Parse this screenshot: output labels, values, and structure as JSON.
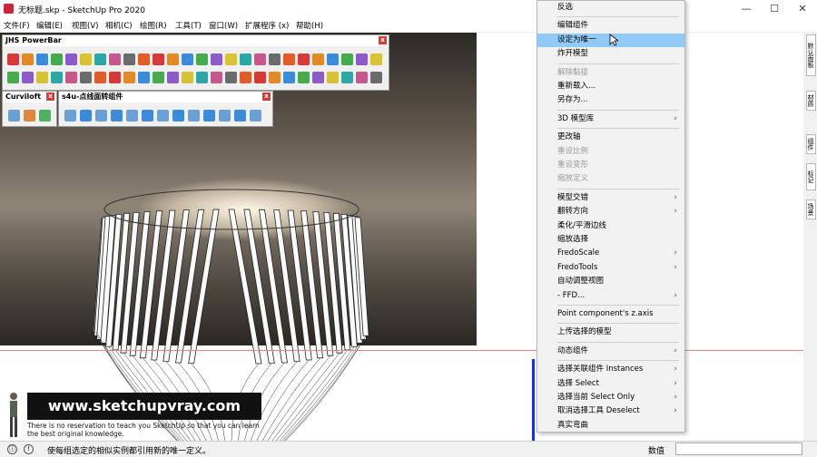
{
  "window": {
    "title": "无标题.skp - SketchUp Pro 2020",
    "minimize": "—",
    "maximize": "☐",
    "close": "✕"
  },
  "menubar": {
    "items": [
      "文件(F)",
      "编辑(E)",
      "视图(V)",
      "相机(C)",
      "绘图(R)",
      "工具(T)",
      "窗口(W)",
      "扩展程序 (x)",
      "帮助(H)"
    ]
  },
  "toolbars": {
    "powerbar": {
      "title": "JHS PowerBar",
      "close": "x"
    },
    "curviloft": {
      "title": "Curviloft",
      "close": "x"
    },
    "s4u": {
      "title": "s4u-点线面转组件",
      "close": "x"
    }
  },
  "context_menu": {
    "items": [
      {
        "label": "反选",
        "disabled": false,
        "submenu": false
      },
      {
        "label": "编辑组件",
        "disabled": false,
        "submenu": false
      },
      {
        "label": "设定为唯一",
        "disabled": false,
        "submenu": false,
        "highlighted": true
      },
      {
        "label": "炸开模型",
        "disabled": false,
        "submenu": false
      },
      {
        "label": "解除黏接",
        "disabled": true,
        "submenu": false
      },
      {
        "label": "重新载入...",
        "disabled": false,
        "submenu": false
      },
      {
        "label": "另存为...",
        "disabled": false,
        "submenu": false
      },
      {
        "label": "3D 模型库",
        "disabled": false,
        "submenu": true
      },
      {
        "label": "更改轴",
        "disabled": false,
        "submenu": false
      },
      {
        "label": "重设比例",
        "disabled": true,
        "submenu": false
      },
      {
        "label": "重设变形",
        "disabled": true,
        "submenu": false
      },
      {
        "label": "缩放定义",
        "disabled": true,
        "submenu": false
      },
      {
        "label": "模型交错",
        "disabled": false,
        "submenu": true
      },
      {
        "label": "翻转方向",
        "disabled": false,
        "submenu": true
      },
      {
        "label": "柔化/平滑边线",
        "disabled": false,
        "submenu": false
      },
      {
        "label": "缩放选择",
        "disabled": false,
        "submenu": false
      },
      {
        "label": "FredoScale",
        "disabled": false,
        "submenu": true
      },
      {
        "label": "FredoTools",
        "disabled": false,
        "submenu": true
      },
      {
        "label": "自动调整视图",
        "disabled": false,
        "submenu": false
      },
      {
        "label": "- FFD...",
        "disabled": false,
        "submenu": true
      },
      {
        "label": "Point component's z.axis",
        "disabled": false,
        "submenu": false
      },
      {
        "label": "上传选择的模型",
        "disabled": false,
        "submenu": false
      },
      {
        "label": "动态组件",
        "disabled": false,
        "submenu": true
      },
      {
        "label": "选择关联组件 Instances",
        "disabled": false,
        "submenu": true
      },
      {
        "label": "选择 Select",
        "disabled": false,
        "submenu": true
      },
      {
        "label": "选择当前 Select Only",
        "disabled": false,
        "submenu": true
      },
      {
        "label": "取消选择工具 Deselect",
        "disabled": false,
        "submenu": true
      },
      {
        "label": "真实弯曲",
        "disabled": false,
        "submenu": false
      }
    ],
    "arrow": "›"
  },
  "side_tabs": [
    "默认面板",
    "材质",
    "组件",
    "标记",
    "场景"
  ],
  "watermark": {
    "url": "www.sketchupvray.com",
    "caption_line1": "There is no reservation to teach you SketchUp so that you can learn",
    "caption_line2": "the best original knowledge."
  },
  "statusbar": {
    "message": "使每组选定的相似实例都引用新的唯一定义。",
    "measurements_label": "数值",
    "icon_1": "ⓘ",
    "icon_2": "!"
  },
  "colors": {
    "highlight": "#91c9f7",
    "axis_red": "#d88888",
    "axis_blue": "#2030d0",
    "watermark_bg": "#111111"
  }
}
